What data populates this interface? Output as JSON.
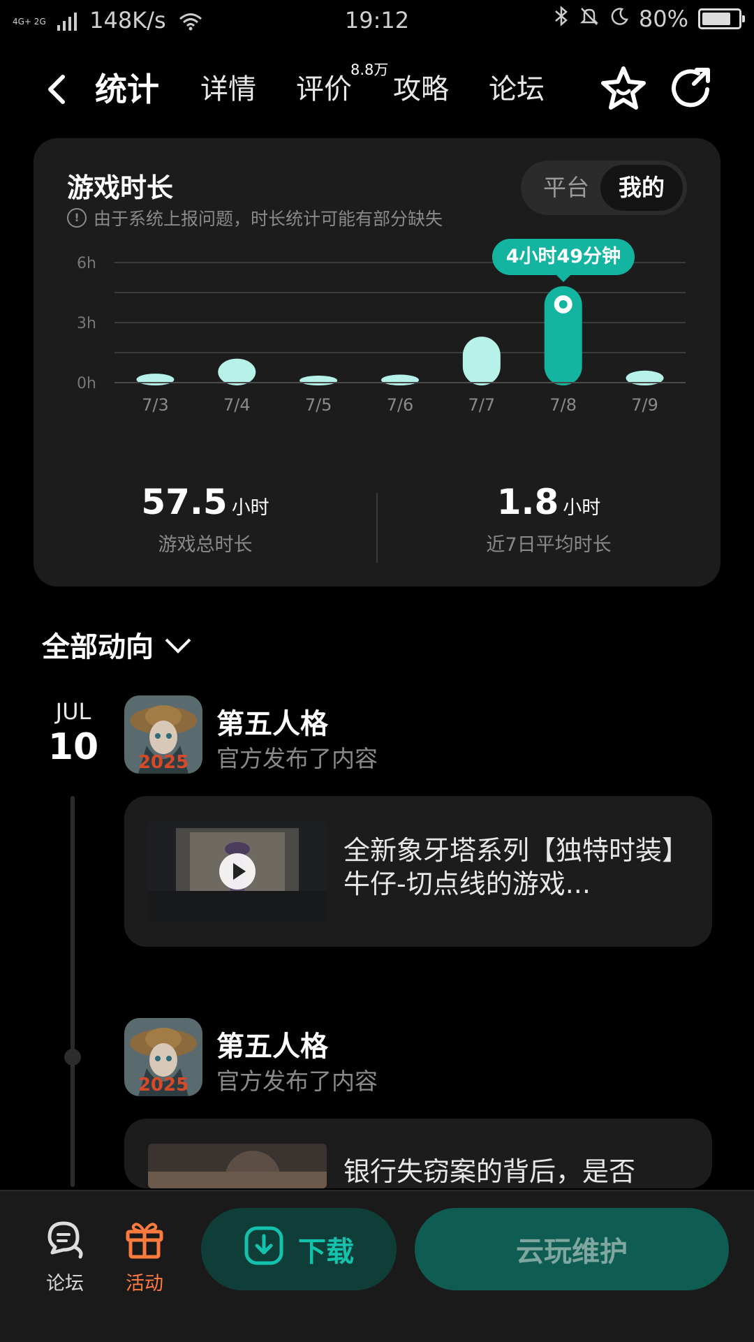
{
  "status_bar": {
    "network_type": "4G+ 2G",
    "speed": "148K/s",
    "time": "19:12",
    "battery": "80%",
    "battery_level": 0.8
  },
  "nav": {
    "tabs": [
      {
        "label": "统计",
        "active": true
      },
      {
        "label": "详情",
        "active": false
      },
      {
        "label": "评价",
        "active": false,
        "badge": "8.8万"
      },
      {
        "label": "攻略",
        "active": false
      },
      {
        "label": "论坛",
        "active": false
      }
    ],
    "icons": [
      "back-arrow-icon",
      "favorite-star-icon",
      "share-icon"
    ]
  },
  "stats_card": {
    "title": "游戏时长",
    "note": "由于系统上报问题，时长统计可能有部分缺失",
    "toggle": [
      "平台",
      "我的"
    ],
    "toggle_selected": "我的",
    "tooltip": "4小时49分钟",
    "total": {
      "value": "57.5",
      "unit": "小时",
      "label": "游戏总时长"
    },
    "average": {
      "value": "1.8",
      "unit": "小时",
      "label": "近7日平均时长"
    }
  },
  "chart_data": {
    "type": "bar",
    "categories": [
      "7/3",
      "7/4",
      "7/5",
      "7/6",
      "7/7",
      "7/8",
      "7/9"
    ],
    "values": [
      0.45,
      1.2,
      0.35,
      0.4,
      2.3,
      4.82,
      0.6
    ],
    "highlight_index": 5,
    "y_ticks": [
      "0h",
      "3h",
      "6h"
    ],
    "ylim": [
      0,
      6
    ],
    "grid": true,
    "colors": {
      "bar": "#b6f2ea",
      "highlight": "#13b5a1",
      "grid": "#3c3c3c"
    }
  },
  "activity": {
    "section_title": "全部动向",
    "date_month": "JUL",
    "date_day": "10",
    "items": [
      {
        "game_name": "第五人格",
        "subtitle": "官方发布了内容",
        "post_title": "全新象牙塔系列【独特时装】牛仔-切点线的游戏...",
        "has_video": true
      },
      {
        "game_name": "第五人格",
        "subtitle": "官方发布了内容",
        "post_title": "银行失窃案的背后，是否"
      }
    ]
  },
  "bottom_bar": {
    "forum_label": "论坛",
    "activity_label": "活动",
    "download_label": "下载",
    "cloud_label": "云玩维护",
    "colors": {
      "accent": "#13b5a1",
      "activity": "#ff7a3d"
    }
  }
}
